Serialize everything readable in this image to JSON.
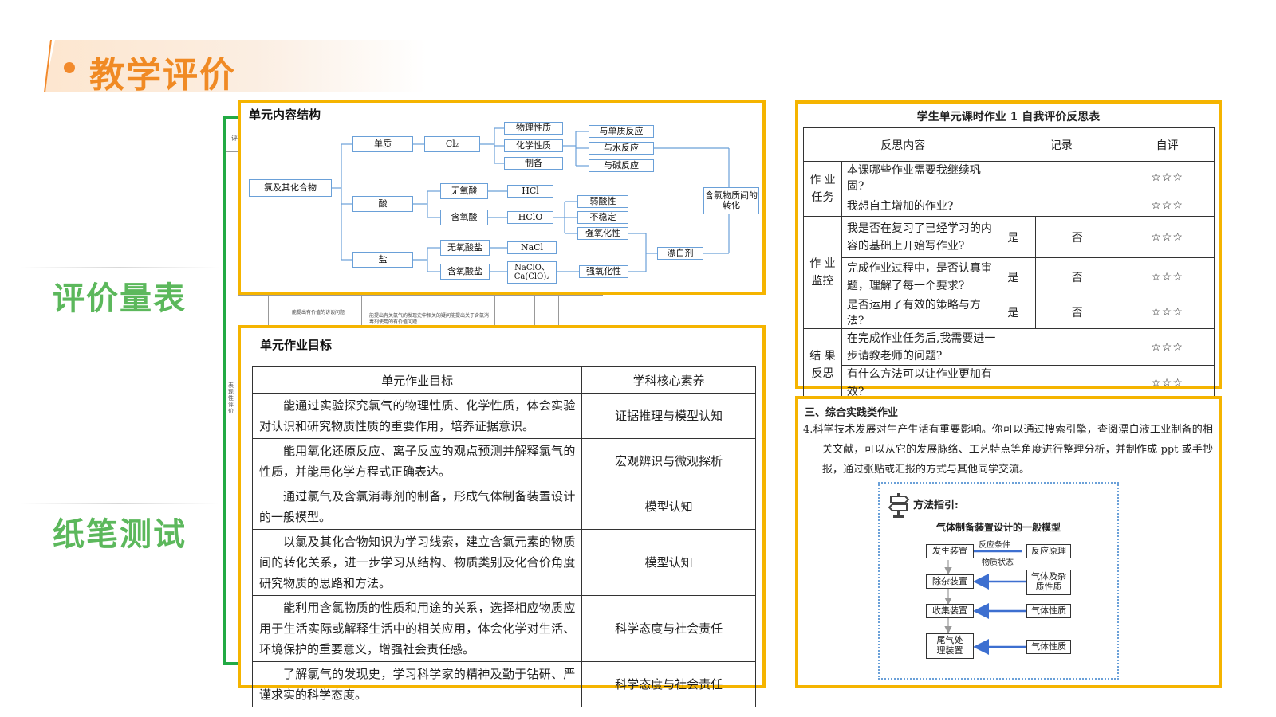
{
  "page": {
    "title": "教学评价"
  },
  "side": {
    "label1": "评价量表",
    "label2": "纸笔测试"
  },
  "bg_doc": {
    "tiny1": "评",
    "tiny2": "表现性评价",
    "tiny3": "能提出有价值的访谈问题",
    "tiny4": "能提出有关氯气的发现史中相关的疑问能提出关于含氯消毒剂使用的有价值问题"
  },
  "structure": {
    "title": "单元内容结构",
    "root": "氯及其化合物",
    "l1": [
      "单质",
      "酸",
      "盐"
    ],
    "cl2": "Cl₂",
    "cl2_props": [
      "物理性质",
      "化学性质",
      "制备"
    ],
    "reactions": [
      "与单质反应",
      "与水反应",
      "与碱反应"
    ],
    "acids": [
      "无氧酸",
      "含氧酸"
    ],
    "hcl": "HCl",
    "hclo": "HClO",
    "hclo_props": [
      "弱酸性",
      "不稳定",
      "强氧化性"
    ],
    "salts": [
      "无氧酸盐",
      "含氧酸盐"
    ],
    "nacl": "NaCl",
    "naclo": "NaClO、Ca(ClO)₂",
    "salt_prop": "强氧化性",
    "bleach": "漂白剂",
    "conversion": "含氯物质间的转化"
  },
  "goals": {
    "title": "单元作业目标",
    "headers": [
      "单元作业目标",
      "学科核心素养"
    ],
    "rows": [
      {
        "goal": "能通过实验探究氯气的物理性质、化学性质，体会实验对认识和研究物质性质的重要作用，培养证据意识。",
        "literacy": "证据推理与模型认知"
      },
      {
        "goal": "能用氧化还原反应、离子反应的观点预测并解释氯气的性质，并能用化学方程式正确表达。",
        "literacy": "宏观辨识与微观探析"
      },
      {
        "goal": "通过氯气及含氯消毒剂的制备，形成气体制备装置设计的一般模型。",
        "literacy": "模型认知"
      },
      {
        "goal": "以氯及其化合物知识为学习线索，建立含氯元素的物质间的转化关系，进一步学习从结构、物质类别及化合价角度研究物质的思路和方法。",
        "literacy": "模型认知"
      },
      {
        "goal": "能利用含氯物质的性质和用途的关系，选择相应物质应用于生活实际或解释生活中的相关应用，体会化学对生活、环境保护的重要意义，增强社会责任感。",
        "literacy": "科学态度与社会责任"
      },
      {
        "goal": "了解氯气的发现史，学习科学家的精神及勤于钻研、严谨求实的科学态度。",
        "literacy": "科学态度与社会责任"
      }
    ]
  },
  "reflection": {
    "title": "学生单元课时作业 1  自我评价反思表",
    "headers": [
      "反思内容",
      "记录",
      "自评"
    ],
    "groups": [
      {
        "name": "作 业任务",
        "items": [
          {
            "q": "本课哪些作业需要我继续巩固?",
            "yn": false
          },
          {
            "q": "我想自主增加的作业?",
            "yn": false
          }
        ]
      },
      {
        "name": "作 业监控",
        "items": [
          {
            "q": "我是否在复习了已经学习的内容的基础上开始写作业?",
            "yn": true
          },
          {
            "q": "完成作业过程中，是否认真审题，理解了每一个要求?",
            "yn": true
          },
          {
            "q": "是否运用了有效的策略与方法?",
            "yn": true
          }
        ]
      },
      {
        "name": "结 果反思",
        "items": [
          {
            "q": "在完成作业任务后,我需要进一步请教老师的问题?",
            "yn": false
          },
          {
            "q": "有什么方法可以让作业更加有效?",
            "yn": false
          }
        ]
      }
    ],
    "yes": "是",
    "no": "否",
    "stars": "☆☆☆"
  },
  "practice": {
    "title": "三、综合实践类作业",
    "text": "4.科学技术发展对生产生活有重要影响。你可以通过搜索引擎，查阅漂白液工业制备的相关文献，可以从它的发展脉络、工艺特点等角度进行整理分析，并制作成 ppt 或手抄报，通过张贴或汇报的方式与其他同学交流。",
    "guide_label": "方法指引:",
    "model_title": "气体制备装置设计的一般模型",
    "left_steps": [
      "发生装置",
      "除杂装置",
      "收集装置",
      "尾气处理装置"
    ],
    "right_boxes": [
      "反应原理",
      "气体及杂质性质",
      "气体性质",
      "气体性质"
    ],
    "conditions": [
      "反应条件",
      "物质状态"
    ]
  },
  "colors": {
    "accent_orange": "#f5b400",
    "title_orange": "#f08a24",
    "green": "#5cb85c",
    "arrow_blue": "#3d6fd0",
    "tree_blue": "#6aa0d8"
  }
}
